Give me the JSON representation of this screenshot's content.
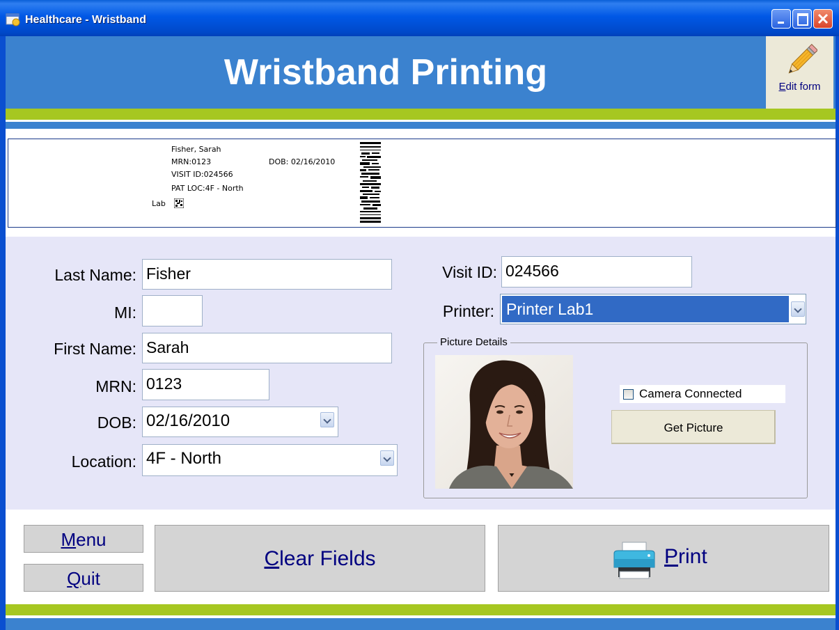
{
  "window": {
    "title": "Healthcare - Wristband"
  },
  "header": {
    "title": "Wristband Printing",
    "edit_form_label_prefix": "E",
    "edit_form_label_rest": "dit form"
  },
  "wristband_preview": {
    "name": "Fisher, Sarah",
    "mrn": "MRN:0123",
    "dob": "DOB: 02/16/2010",
    "visit_id": "VISIT ID:024566",
    "pat_loc": "PAT LOC:4F - North",
    "lab": "Lab"
  },
  "form": {
    "last_name": {
      "label": "Last Name:",
      "value": "Fisher"
    },
    "mi": {
      "label": "MI:",
      "value": ""
    },
    "first_name": {
      "label": "First Name:",
      "value": "Sarah"
    },
    "mrn": {
      "label": "MRN:",
      "value": "0123"
    },
    "dob": {
      "label": "DOB:",
      "value": "02/16/2010"
    },
    "location": {
      "label": "Location:",
      "value": "4F - North"
    },
    "visit_id": {
      "label": "Visit ID:",
      "value": "024566"
    },
    "printer": {
      "label": "Printer:",
      "value": "Printer Lab1"
    }
  },
  "picture_details": {
    "group_label": "Picture Details",
    "camera_connected_label": "Camera Connected",
    "camera_connected": false,
    "get_picture_label": "Get Picture"
  },
  "buttons": {
    "menu_mnemonic": "M",
    "menu_rest": "enu",
    "quit_mnemonic": "Q",
    "quit_rest": "uit",
    "clear_mnemonic": "C",
    "clear_rest": "lear Fields",
    "print_mnemonic": "P",
    "print_rest": "rint"
  },
  "colors": {
    "header_blue": "#3b82cf",
    "accent_green": "#a6c721",
    "panel_bg": "#e6e6f8",
    "selection_blue": "#316ac5",
    "link_navy": "#000080"
  },
  "icons": [
    "app-icon",
    "minimize-icon",
    "maximize-icon",
    "close-icon",
    "pencil-icon",
    "chevron-down-icon",
    "printer-icon",
    "barcode",
    "data-matrix"
  ]
}
